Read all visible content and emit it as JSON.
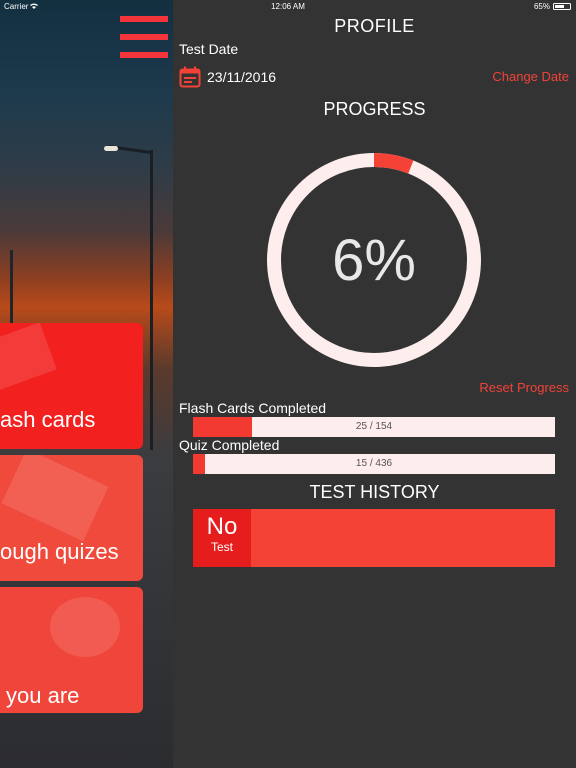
{
  "status_bar": {
    "carrier": "Carrier",
    "time": "12:06 AM",
    "battery": "65%",
    "battery_level": 0.65
  },
  "side_cards": [
    {
      "label": "ash cards"
    },
    {
      "label": "ough quizes"
    },
    {
      "label": "you are"
    }
  ],
  "profile": {
    "title": "PROFILE",
    "test_date_label": "Test Date",
    "test_date_value": "23/11/2016",
    "change_date_label": "Change Date"
  },
  "progress": {
    "title": "PROGRESS",
    "percent_text": "6%",
    "percent": 6,
    "reset_label": "Reset Progress"
  },
  "stats": {
    "flash": {
      "label": "Flash Cards Completed",
      "text": "25 / 154",
      "done": 25,
      "total": 154
    },
    "quiz": {
      "label": "Quiz Completed",
      "text": "15 / 436",
      "done": 15,
      "total": 436
    }
  },
  "history": {
    "title": "TEST HISTORY",
    "badge_main": "No",
    "badge_sub": "Test"
  },
  "colors": {
    "accent": "#f44336",
    "accent_dark": "#e61d1d",
    "background": "#333333",
    "track": "#fdeded"
  }
}
